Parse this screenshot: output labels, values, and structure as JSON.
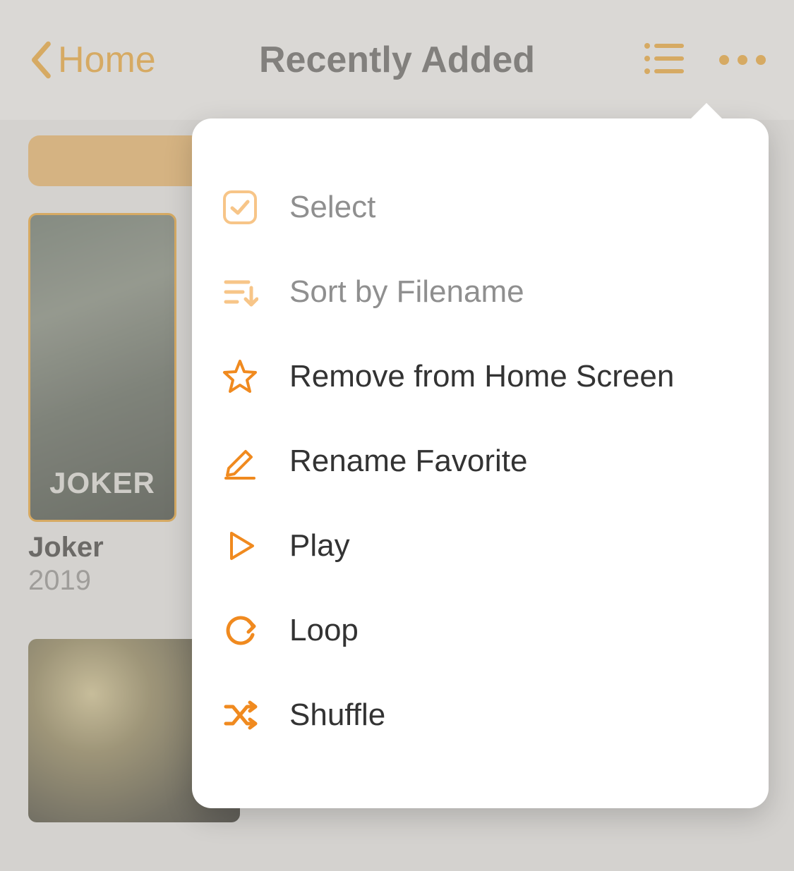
{
  "header": {
    "back_label": "Home",
    "title": "Recently Added"
  },
  "posters": [
    {
      "title": "Joker",
      "year": "2019"
    }
  ],
  "menu": {
    "items": [
      {
        "label": "Select"
      },
      {
        "label": "Sort by Filename"
      },
      {
        "label": "Remove from Home Screen"
      },
      {
        "label": "Rename Favorite"
      },
      {
        "label": "Play"
      },
      {
        "label": "Loop"
      },
      {
        "label": "Shuffle"
      }
    ]
  }
}
